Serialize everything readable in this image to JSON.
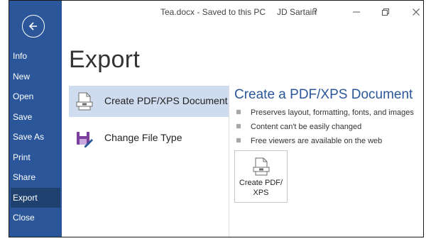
{
  "window": {
    "document_title": "Tea.docx  -  Saved to this PC",
    "user_name": "JD Sartain",
    "help_label": "?"
  },
  "sidebar": {
    "items": [
      {
        "label": "Info"
      },
      {
        "label": "New"
      },
      {
        "label": "Open"
      },
      {
        "label": "Save"
      },
      {
        "label": "Save As"
      },
      {
        "label": "Print"
      },
      {
        "label": "Share"
      },
      {
        "label": "Export",
        "active": true
      },
      {
        "label": "Close"
      }
    ]
  },
  "main": {
    "page_title": "Export",
    "options": [
      {
        "label": "Create PDF/XPS Document",
        "selected": true,
        "icon": "pdf-document-icon"
      },
      {
        "label": "Change File Type",
        "selected": false,
        "icon": "change-file-type-icon"
      }
    ],
    "detail": {
      "title": "Create a PDF/XPS Document",
      "bullets": [
        "Preserves layout, formatting, fonts, and images",
        "Content can't be easily changed",
        "Free viewers are available on the web"
      ],
      "button_label": "Create PDF/\nXPS"
    }
  },
  "colors": {
    "sidebar_bg": "#2b579a",
    "sidebar_active": "#1f4170",
    "selected_option": "#cfdcf0",
    "accent_text": "#2b579a"
  }
}
